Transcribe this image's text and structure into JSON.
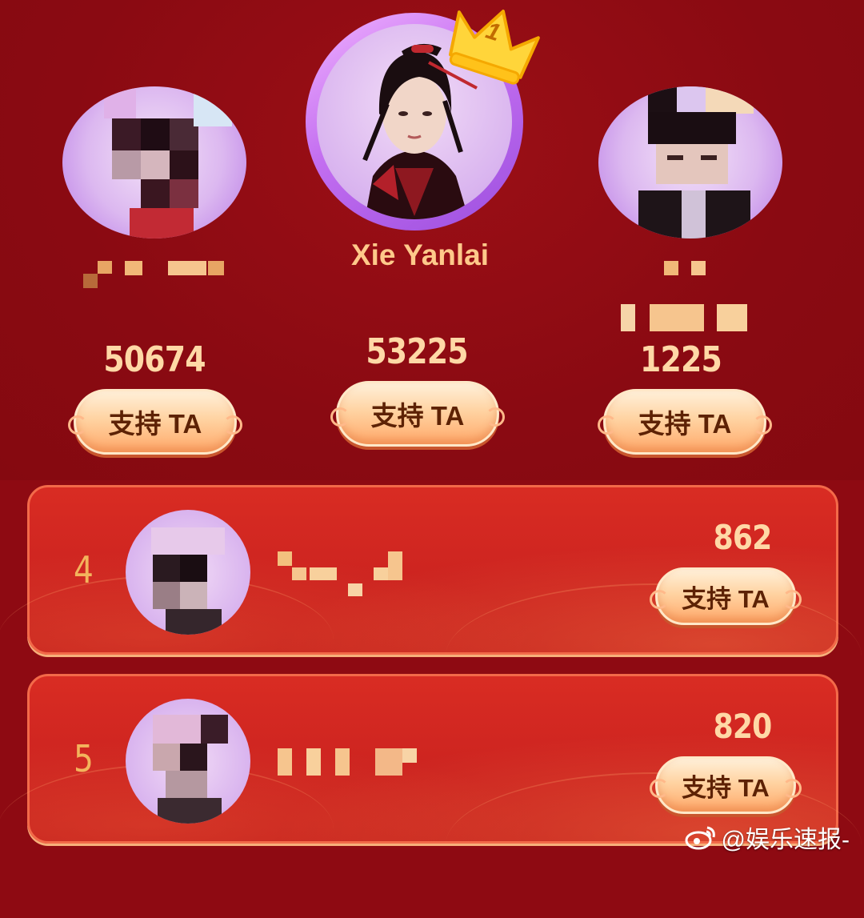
{
  "top3": {
    "first": {
      "rank": "1",
      "name": "Xie Yanlai",
      "score": "53225",
      "support_label": "支持 TA"
    },
    "second": {
      "score": "50674",
      "support_label": "支持 TA"
    },
    "third": {
      "score": "1225",
      "support_label": "支持 TA"
    }
  },
  "rankings": [
    {
      "rank": "4",
      "score": "862",
      "support_label": "支持 TA"
    },
    {
      "rank": "5",
      "score": "820",
      "support_label": "支持 TA"
    }
  ],
  "watermark": {
    "text": "@娱乐速报-",
    "icon": "weibo-icon"
  },
  "colors": {
    "background": "#8e0a12",
    "row_background": "#d92c23",
    "score_text": "#ffd8a6",
    "button_text": "#5d2205"
  }
}
